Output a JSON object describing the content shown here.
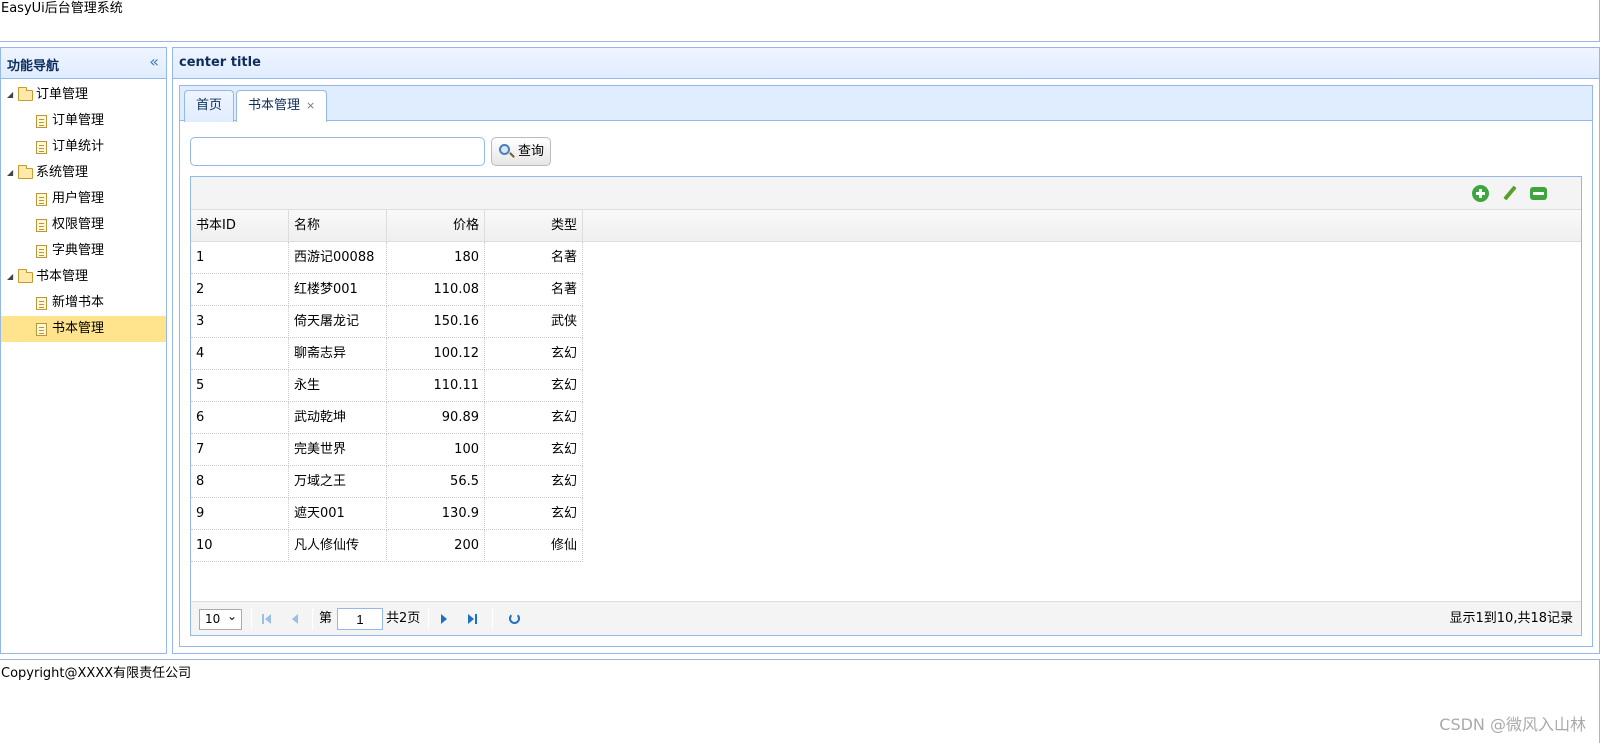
{
  "header": {
    "title": "EasyUi后台管理系统"
  },
  "west": {
    "title": "功能导航",
    "collapse_icon": "double-chevron-left-icon",
    "tree": [
      {
        "label": "订单管理",
        "type": "folder",
        "children": [
          {
            "label": "订单管理",
            "type": "file"
          },
          {
            "label": "订单统计",
            "type": "file"
          }
        ]
      },
      {
        "label": "系统管理",
        "type": "folder",
        "children": [
          {
            "label": "用户管理",
            "type": "file"
          },
          {
            "label": "权限管理",
            "type": "file"
          },
          {
            "label": "字典管理",
            "type": "file"
          }
        ]
      },
      {
        "label": "书本管理",
        "type": "folder",
        "children": [
          {
            "label": "新增书本",
            "type": "file"
          },
          {
            "label": "书本管理",
            "type": "file",
            "selected": true
          }
        ]
      }
    ],
    "selected_color": "#ffe48d"
  },
  "center": {
    "title": "center title",
    "tabs": [
      {
        "label": "首页",
        "closable": false
      },
      {
        "label": "书本管理",
        "closable": true,
        "active": true,
        "close_glyph": "×"
      }
    ],
    "search": {
      "value": "",
      "placeholder": "",
      "button_label": "查询",
      "button_icon": "search-icon"
    },
    "toolbar_icons": [
      "add-icon",
      "edit-icon",
      "remove-icon"
    ],
    "grid": {
      "columns": [
        "书本ID",
        "名称",
        "价格",
        "类型"
      ],
      "rows": [
        [
          "1",
          "西游记00088",
          "180",
          "名著"
        ],
        [
          "2",
          "红楼梦001",
          "110.08",
          "名著"
        ],
        [
          "3",
          "倚天屠龙记",
          "150.16",
          "武侠"
        ],
        [
          "4",
          "聊斋志异",
          "100.12",
          "玄幻"
        ],
        [
          "5",
          "永生",
          "110.11",
          "玄幻"
        ],
        [
          "6",
          "武动乾坤",
          "90.89",
          "玄幻"
        ],
        [
          "7",
          "完美世界",
          "100",
          "玄幻"
        ],
        [
          "8",
          "万域之王",
          "56.5",
          "玄幻"
        ],
        [
          "9",
          "遮天001",
          "130.9",
          "玄幻"
        ],
        [
          "10",
          "凡人修仙传",
          "200",
          "修仙"
        ]
      ]
    },
    "pager": {
      "page_size": "10",
      "page_prefix": "第",
      "current_page": "1",
      "total_pages_text": "共2页",
      "info": "显示1到10,共18记录"
    }
  },
  "south": {
    "text": "Copyright@XXXX有限责任公司"
  },
  "watermark": "CSDN @微风入山林",
  "colors": {
    "border": "#95b8e7",
    "header_bg": "#e0ecff",
    "pager_icon": "#1f6fc6"
  }
}
